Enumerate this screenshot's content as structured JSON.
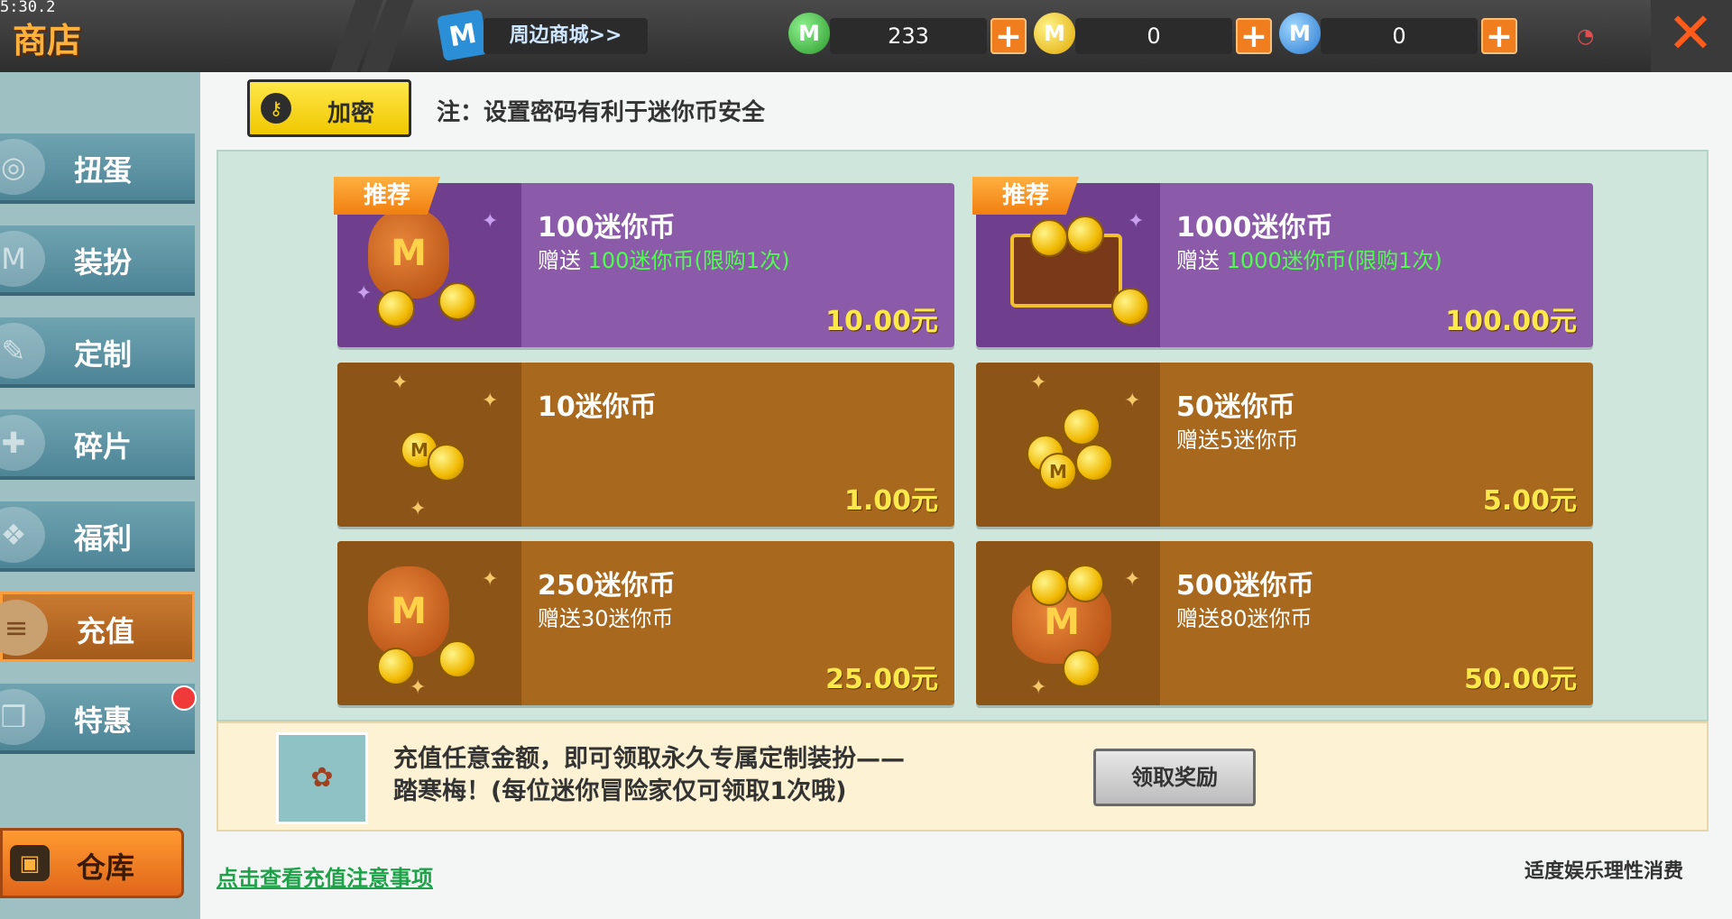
{
  "status": {
    "clock": "5:30.2"
  },
  "header": {
    "title": "商店",
    "mall_label": "周边商城>>",
    "currencies": [
      {
        "icon": "green-mini-coin-icon",
        "value": "233"
      },
      {
        "icon": "gold-mini-coin-icon",
        "value": "0"
      },
      {
        "icon": "blue-mini-coin-icon",
        "value": "0"
      }
    ],
    "plus": "+",
    "close": "✕"
  },
  "sidebar": {
    "items": [
      {
        "label": "扭蛋",
        "icon": "capsule-icon"
      },
      {
        "label": "装扮",
        "icon": "outfit-icon"
      },
      {
        "label": "定制",
        "icon": "pencil-icon"
      },
      {
        "label": "碎片",
        "icon": "puzzle-icon"
      },
      {
        "label": "福利",
        "icon": "gift-icon"
      },
      {
        "label": "充值",
        "icon": "coin-stack-icon",
        "active": true
      },
      {
        "label": "特惠",
        "icon": "present-icon",
        "has_dot": true
      }
    ],
    "warehouse_label": "仓库"
  },
  "security": {
    "button_label": "加密",
    "note": "注：设置密码有利于迷你币安全"
  },
  "products": [
    {
      "title": "100迷你币",
      "gift_prefix": "赠送",
      "gift": "100迷你币(限购1次)",
      "price": "10.00元",
      "badge": "推荐",
      "style": "purple"
    },
    {
      "title": "1000迷你币",
      "gift_prefix": "赠送",
      "gift": "1000迷你币(限购1次)",
      "price": "100.00元",
      "badge": "推荐",
      "style": "purple"
    },
    {
      "title": "10迷你币",
      "gift_prefix": "",
      "gift": "",
      "price": "1.00元",
      "style": "brown"
    },
    {
      "title": "50迷你币",
      "gift_prefix": "赠送5迷你币",
      "gift": "",
      "price": "5.00元",
      "style": "brown"
    },
    {
      "title": "250迷你币",
      "gift_prefix": "赠送30迷你币",
      "gift": "",
      "price": "25.00元",
      "style": "brown"
    },
    {
      "title": "500迷你币",
      "gift_prefix": "赠送80迷你币",
      "gift": "",
      "price": "50.00元",
      "style": "brown"
    }
  ],
  "promo": {
    "text_line1": "充值任意金额，即可领取永久专属定制装扮——",
    "text_line2": "踏寒梅！(每位迷你冒险家仅可领取1次哦)",
    "claim_label": "领取奖励"
  },
  "footer": {
    "link": "点击查看充值注意事项",
    "hint": "适度娱乐理性消费"
  },
  "colors": {
    "accent": "#f07d1e",
    "purple_card": "#8b5aa8",
    "brown_card": "#a8691f",
    "price": "#ffe94a",
    "gift_green": "#4dff4d"
  }
}
